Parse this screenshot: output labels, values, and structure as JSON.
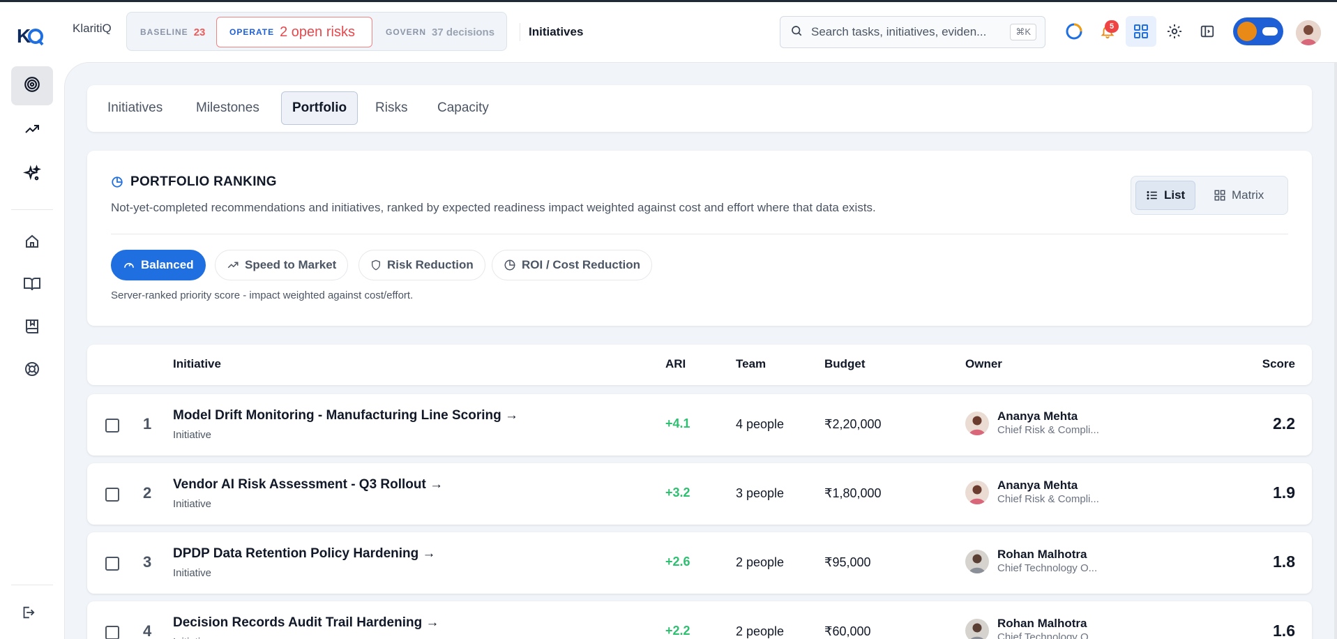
{
  "app": {
    "brand": "KlaritiQ",
    "page_heading": "Initiatives"
  },
  "phases": {
    "baseline": {
      "tag": "BASELINE",
      "value": "23"
    },
    "operate": {
      "tag": "OPERATE",
      "value": "2 open risks"
    },
    "govern": {
      "tag": "GOVERN",
      "value": "37 decisions"
    }
  },
  "search": {
    "placeholder": "Search tasks, initiatives, eviden...",
    "shortcut": "⌘K"
  },
  "notifications": {
    "count": "5"
  },
  "sidebar": {
    "items": [
      {
        "icon": "target-icon",
        "active": true
      },
      {
        "icon": "trending-up-icon"
      },
      {
        "icon": "sparkles-icon"
      },
      {
        "icon": "home-icon"
      },
      {
        "icon": "book-open-icon"
      },
      {
        "icon": "bookmark-book-icon"
      },
      {
        "icon": "lifebuoy-icon"
      },
      {
        "icon": "logout-icon"
      }
    ]
  },
  "tabs": [
    {
      "label": "Initiatives"
    },
    {
      "label": "Milestones"
    },
    {
      "label": "Portfolio",
      "active": true
    },
    {
      "label": "Risks"
    },
    {
      "label": "Capacity"
    }
  ],
  "ranking": {
    "title": "PORTFOLIO RANKING",
    "description": "Not-yet-completed recommendations and initiatives, ranked by expected readiness impact weighted against cost and effort where that data exists.",
    "views": {
      "list": "List",
      "matrix": "Matrix"
    },
    "modes": [
      {
        "label": "Balanced",
        "icon": "gauge-icon",
        "active": true
      },
      {
        "label": "Speed to Market",
        "icon": "trending-up-icon"
      },
      {
        "label": "Risk Reduction",
        "icon": "shield-icon"
      },
      {
        "label": "ROI / Cost Reduction",
        "icon": "pie-chart-icon"
      }
    ],
    "note": "Server-ranked priority score - impact weighted against cost/effort."
  },
  "table": {
    "headers": {
      "initiative": "Initiative",
      "ari": "ARI",
      "team": "Team",
      "budget": "Budget",
      "owner": "Owner",
      "score": "Score"
    },
    "rows": [
      {
        "rank": "1",
        "name": "Model Drift Monitoring - Manufacturing Line Scoring →",
        "type": "Initiative",
        "ari": "+4.1",
        "team": "4 people",
        "budget": "₹2,20,000",
        "owner": "Ananya Mehta",
        "role": "Chief Risk & Compli...",
        "score": "2.2"
      },
      {
        "rank": "2",
        "name": "Vendor AI Risk Assessment - Q3 Rollout →",
        "type": "Initiative",
        "ari": "+3.2",
        "team": "3 people",
        "budget": "₹1,80,000",
        "owner": "Ananya Mehta",
        "role": "Chief Risk & Compli...",
        "score": "1.9"
      },
      {
        "rank": "3",
        "name": "DPDP Data Retention Policy Hardening →",
        "type": "Initiative",
        "ari": "+2.6",
        "team": "2 people",
        "budget": "₹95,000",
        "owner": "Rohan Malhotra",
        "role": "Chief Technology O...",
        "score": "1.8"
      },
      {
        "rank": "4",
        "name": "Decision Records Audit Trail Hardening →",
        "type": "Initiative",
        "ari": "+2.2",
        "team": "2 people",
        "budget": "₹60,000",
        "owner": "Rohan Malhotra",
        "role": "Chief Technology O...",
        "score": "1.6"
      }
    ]
  },
  "colors": {
    "accent": "#1f6fe0",
    "risk": "#e5484d",
    "positive": "#2fbf71"
  }
}
